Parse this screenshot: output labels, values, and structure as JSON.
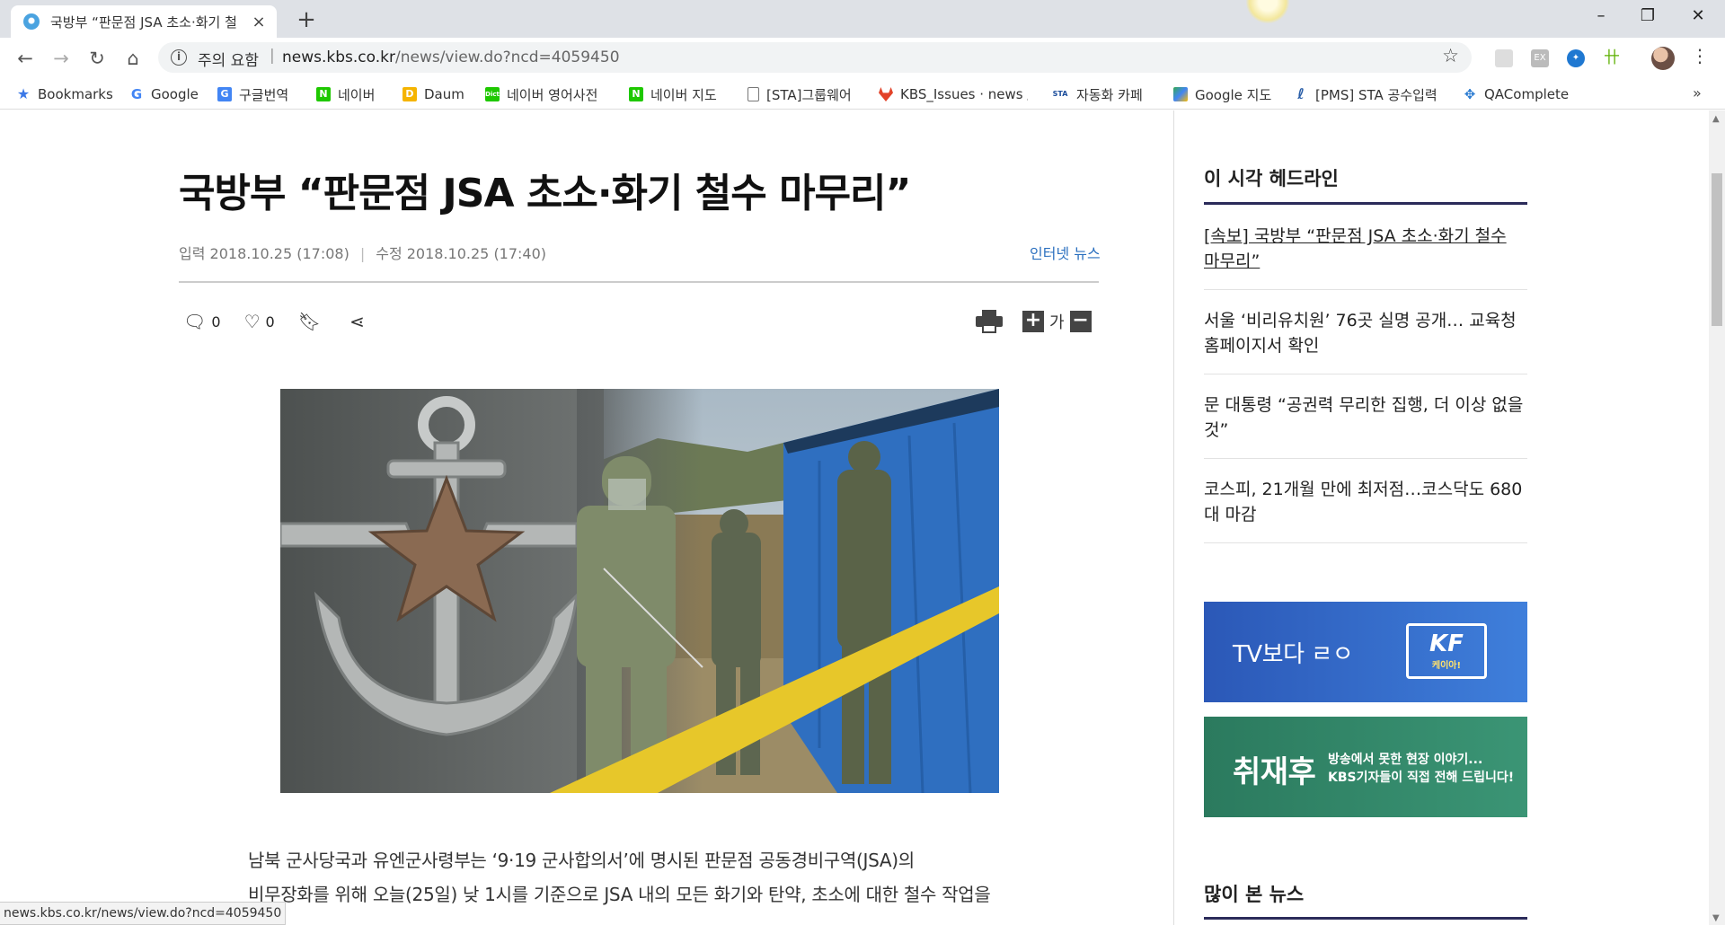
{
  "browser": {
    "tab_title": "국방부 “판문점 JSA 초소·화기 철",
    "new_tab": "+",
    "window_controls": {
      "minimize": "–",
      "restore": "❐",
      "close": "✕"
    },
    "security_label": "주의 요함",
    "url_host": "news.kbs.co.kr",
    "url_path": "/news/view.do?ncd=4059450"
  },
  "bookmarks": [
    {
      "label": "Bookmarks",
      "icon": "star-icon",
      "color": "#3b78e7"
    },
    {
      "label": "Google",
      "icon": "google-icon",
      "color": "#4285f4"
    },
    {
      "label": "구글번역",
      "icon": "translate-icon",
      "color": "#4285f4"
    },
    {
      "label": "네이버",
      "icon": "naver-icon",
      "color": "#1ec800"
    },
    {
      "label": "Daum",
      "icon": "daum-icon",
      "color": "#f5b400"
    },
    {
      "label": "네이버 영어사전",
      "icon": "dict-icon",
      "color": "#1ec800"
    },
    {
      "label": "네이버 지도",
      "icon": "naver-icon",
      "color": "#1ec800"
    },
    {
      "label": "[STA]그룹웨어",
      "icon": "page-icon",
      "color": "#888888"
    },
    {
      "label": "KBS_Issues · news / ...",
      "icon": "gitlab-icon",
      "color": "#e24329"
    },
    {
      "label": "자동화 카페",
      "icon": "sta-icon",
      "color": "#1b4d9b"
    },
    {
      "label": "Google 지도",
      "icon": "maps-icon",
      "color": "#34a853"
    },
    {
      "label": "[PMS] STA 공수입력",
      "icon": "pms-icon",
      "color": "#2b5fa8"
    },
    {
      "label": "QAComplete",
      "icon": "qa-icon",
      "color": "#2a7bd1"
    }
  ],
  "article": {
    "headline": "국방부 “판문점 JSA 초소·화기 철수 마무리”",
    "input_date": "입력 2018.10.25 (17:08)",
    "modified_date": "수정 2018.10.25 (17:40)",
    "category": "인터넷 뉴스",
    "comment_count": "0",
    "like_count": "0",
    "font_size_label": "가",
    "body_line1": "남북 군사당국과 유엔군사령부는 ‘9·19 군사합의서’에 명시된 판문점 공동경비구역(JSA)의",
    "body_line2": "비무장화를 위해 오늘(25일) 낮 1시를 기준으로 JSA 내의 모든 화기와 탄약, 초소에 대한 철수 작업을"
  },
  "sidebar": {
    "headlines_title": "이 시각 헤드라인",
    "headlines": [
      "[속보] 국방부 “판문점 JSA 초소·화기 철수 마무리”",
      "서울 ‘비리유치원’ 76곳 실명 공개… 교육청 홈페이지서 확인",
      "문 대통령 “공권력 무리한 집행, 더 이상 없을 것”",
      "코스피, 21개월 만에 최저점…코스닥도 680대 마감"
    ],
    "banner1_text": "TV보다 ㄹㅇ",
    "banner1_logo": "KF",
    "banner1_logo_sub": "케이아!",
    "banner2_title": "취재후",
    "banner2_line1": "방송에서 못한 현장 이야기...",
    "banner2_line2": "KBS기자들이 직접 전해 드립니다!",
    "popular_title": "많이 본 뉴스"
  },
  "status_url": "news.kbs.co.kr/news/view.do?ncd=4059450"
}
